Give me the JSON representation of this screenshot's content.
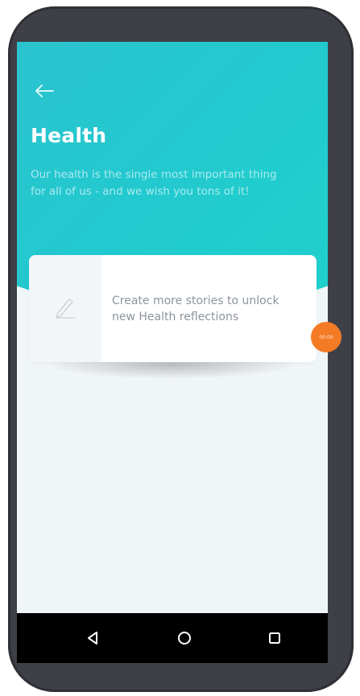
{
  "header": {
    "back_icon": "back-arrow-icon",
    "title": "Health",
    "description": "Our health is the single most important thing for all of us - and we wish you tons of it!"
  },
  "reflection_card": {
    "icon": "pencil-icon",
    "message": "Create more stories to unlock new Health reflections"
  },
  "timer_badge": {
    "label": "00:00"
  },
  "navigation_bar": {
    "back_icon": "triangle-back-icon",
    "home_icon": "circle-home-icon",
    "recents_icon": "square-recents-icon"
  },
  "colors": {
    "header_gradient_start": "#2bc3cf",
    "header_gradient_end": "#1fd2cc",
    "screen_background": "#f0f5f8",
    "card_text": "#8d949c",
    "timer_badge": "#f47a24",
    "phone_frame": "#3f4047",
    "navigation_bar": "#000000"
  }
}
